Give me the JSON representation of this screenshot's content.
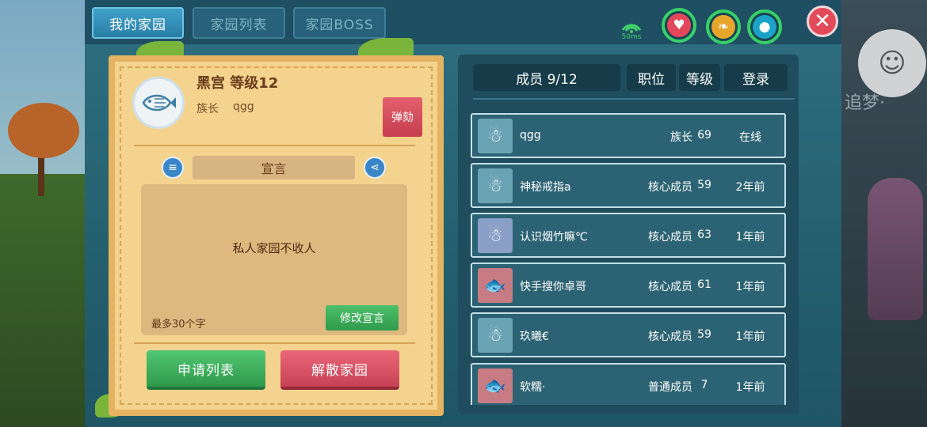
{
  "tabs": [
    {
      "label": "我的家园",
      "active": true
    },
    {
      "label": "家园列表",
      "active": false
    },
    {
      "label": "家园BOSS",
      "active": false
    }
  ],
  "status": {
    "ping": "50ms",
    "icons": [
      "signal-icon",
      "heart-icon",
      "hunger-icon",
      "water-icon"
    ]
  },
  "home": {
    "name": "黑宫 等级12",
    "leader_label": "族长",
    "leader_name": "qgg",
    "impeach_label": "弹劾",
    "declaration_title": "宣言",
    "declaration_text": "私人家园不收人",
    "max_chars_hint": "最多30个字",
    "edit_label": "修改宣言",
    "apply_list_label": "申请列表",
    "dissolve_label": "解散家园"
  },
  "member_headers": {
    "members": "成员 9/12",
    "role": "职位",
    "level": "等级",
    "login": "登录"
  },
  "members": [
    {
      "name": "qgg",
      "role": "族长",
      "level": "69",
      "login": "在线"
    },
    {
      "name": "神秘戒指a",
      "role": "核心成员",
      "level": "59",
      "login": "2年前"
    },
    {
      "name": "认识烟竹嘛℃",
      "role": "核心成员",
      "level": "63",
      "login": "1年前"
    },
    {
      "name": "快手搜你卓哥",
      "role": "核心成员",
      "level": "61",
      "login": "1年前"
    },
    {
      "name": "玖曦€",
      "role": "核心成员",
      "level": "59",
      "login": "1年前"
    },
    {
      "name": "软糯·",
      "role": "普通成员",
      "level": "7",
      "login": "1年前"
    }
  ],
  "background_text": "追梦·",
  "colors": {
    "accent_blue": "#3fa1c9",
    "card": "#f3d38e",
    "green_button": "#2f9a4c",
    "red_button": "#c64256"
  }
}
